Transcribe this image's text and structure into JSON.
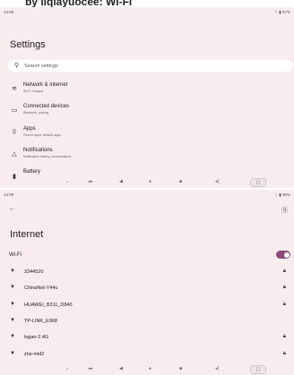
{
  "caption": "by liqiayuocee: Wi-Fi",
  "screen1": {
    "status_time": "13:08",
    "status_right": "97%",
    "title": "Settings",
    "search_placeholder": "Search settings",
    "items": [
      {
        "icon": "wifi-icon",
        "glyph": "≋",
        "title": "Network & internet",
        "sub": "Wi-Fi, hotspot"
      },
      {
        "icon": "devices-icon",
        "glyph": "▭",
        "title": "Connected devices",
        "sub": "Bluetooth, pairing"
      },
      {
        "icon": "apps-icon",
        "glyph": "⠿",
        "title": "Apps",
        "sub": "Recent apps, default apps"
      },
      {
        "icon": "bell-icon",
        "glyph": "△",
        "title": "Notifications",
        "sub": "Notification history, conversations"
      },
      {
        "icon": "battery-icon",
        "glyph": "▮",
        "title": "Battery",
        "sub": ""
      }
    ]
  },
  "screen2": {
    "status_time": "13:08",
    "status_right": "96%",
    "title": "Internet",
    "wifi_label": "Wi-Fi",
    "wifi_on": true,
    "networks": [
      {
        "name": "3344520"
      },
      {
        "name": "ChinaNet-Y44u"
      },
      {
        "name": "HUAWEI_B311_D840"
      },
      {
        "name": "TP-LINK_E968"
      },
      {
        "name": "logan-2.4G"
      },
      {
        "name": "zhs-mid2"
      }
    ]
  },
  "nav": {
    "items": [
      "⌄",
      "◂◂",
      "◀",
      "●",
      "■",
      "◂)",
      "▢"
    ]
  }
}
